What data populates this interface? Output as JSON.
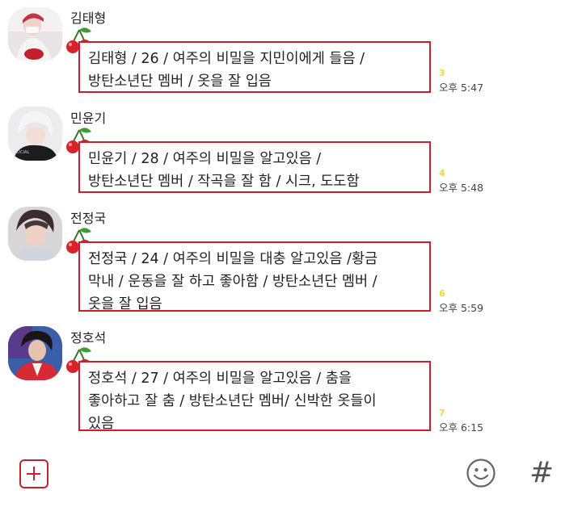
{
  "messages": [
    {
      "sender": "김태형",
      "lines": [
        "김태형 / 26 / 여주의 비밀을 지민이에게 들음 /",
        "방탄소년단 멤버 / 옷을 잘 입음"
      ],
      "read_count": "3",
      "time": "오후 5:47",
      "avatar_icon": "profile-photo"
    },
    {
      "sender": "민윤기",
      "lines": [
        "민윤기 / 28 / 여주의 비밀을 알고있음 /",
        "방탄소년단 멤버 / 작곡을 잘 함 / 시크, 도도함"
      ],
      "read_count": "4",
      "time": "오후 5:48",
      "avatar_icon": "profile-photo"
    },
    {
      "sender": "전정국",
      "lines": [
        "전정국 / 24 / 여주의 비밀을 대충 알고있음 /황금",
        "막내 / 운동을 잘 하고 좋아함 / 방탄소년단 멤버 /",
        "옷을 잘 입음"
      ],
      "read_count": "6",
      "time": "오후 5:59",
      "avatar_icon": "profile-photo"
    },
    {
      "sender": "정호석",
      "lines": [
        "정호석 / 27 / 여주의 비밀을 알고있음 / 춤을",
        "좋아하고 잘 춤 / 방탄소년단 멤버/ 신박한 옷들이",
        "있음"
      ],
      "read_count": "7",
      "time": "오후 6:15",
      "avatar_icon": "profile-photo"
    }
  ],
  "input_bar": {
    "add_icon": "plus-square-icon",
    "emoji_icon": "smiley-icon",
    "hash_label": "#"
  },
  "colors": {
    "accent": "#c8202f",
    "read_count": "#f3d641",
    "cherry": "#d8232a",
    "leaf": "#3f9a3a"
  }
}
